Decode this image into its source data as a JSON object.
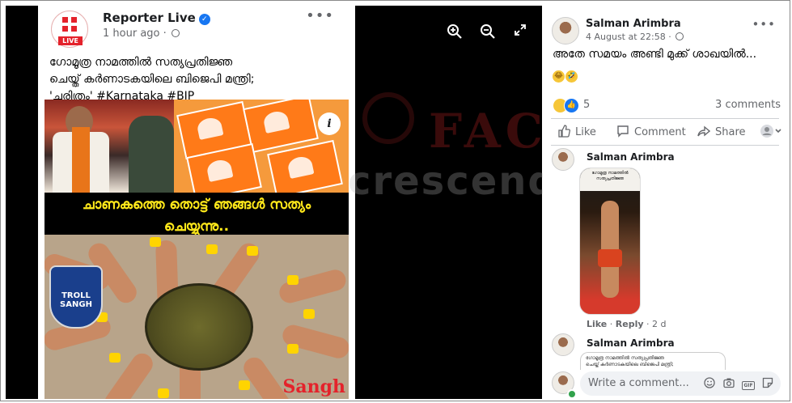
{
  "post": {
    "page_name": "Reporter Live",
    "logo_badge": "LIVE",
    "time": "1 hour ago",
    "time_separator": "·",
    "more": "•••",
    "caption_line1": "ഗോമൂത്ര നാമത്തിൽ സത്യപ്രതിജ്ഞ",
    "caption_line2": "ചെയ്ത് കർണാടകയിലെ ബിജെപി മന്ത്രി;",
    "caption_line3": "'ചരിത്രം' #Karnataka #BJP",
    "meme_line1": "ചാണകത്തെ തൊട്ട് ഞങ്ങൾ സത്യം",
    "meme_line2": "ചെയ്യുന്നു..",
    "troll_badge_line1": "TROLL",
    "troll_badge_line2": "SANGH",
    "image_bottom_text": "Sangh",
    "info_badge": "i"
  },
  "viewer": {
    "zoom_in_icon": "zoom-in-icon",
    "zoom_out_icon": "zoom-out-icon",
    "fullscreen_icon": "fullscreen-icon"
  },
  "comment": {
    "author": "Salman Arimbra",
    "date": "4 August at 22:58",
    "date_separator": "·",
    "more": "•••",
    "text": "അതേ സമയം അണ്ടി മുക്ക് ശാഖയിൽ...",
    "emoji": [
      "😂",
      "🤣"
    ],
    "reaction_count": "5",
    "comments_count": "3 comments"
  },
  "actions": {
    "like": "Like",
    "comment": "Comment",
    "share": "Share"
  },
  "reply": {
    "author": "Salman Arimbra",
    "image_caption": "ഗോമൂത്ര നാമത്തിൽ സത്യപ്രതിജ്ഞ",
    "like": "Like",
    "separator": "·",
    "reply": "Reply",
    "time": "2 d"
  },
  "reply2": {
    "author": "Salman Arimbra",
    "quote_line1": "ഗോമൂത്ര നാമത്തിൽ സത്യപ്രതിജ്ഞ",
    "quote_line2": "ചെയ്ത് കർണാടകയിലെ ബിജെപി മന്ത്രി;"
  },
  "composer": {
    "placeholder": "Write a comment...",
    "icons": [
      "emoji-icon",
      "camera-icon",
      "gif-icon",
      "sticker-icon"
    ],
    "gif_label": "GIF"
  },
  "watermark": {
    "line1": "FACT",
    "line2": "crescendo"
  },
  "colors": {
    "facebook_blue": "#1877f2",
    "meme_yellow": "#ffe81a",
    "brand_red": "#e4222b"
  }
}
